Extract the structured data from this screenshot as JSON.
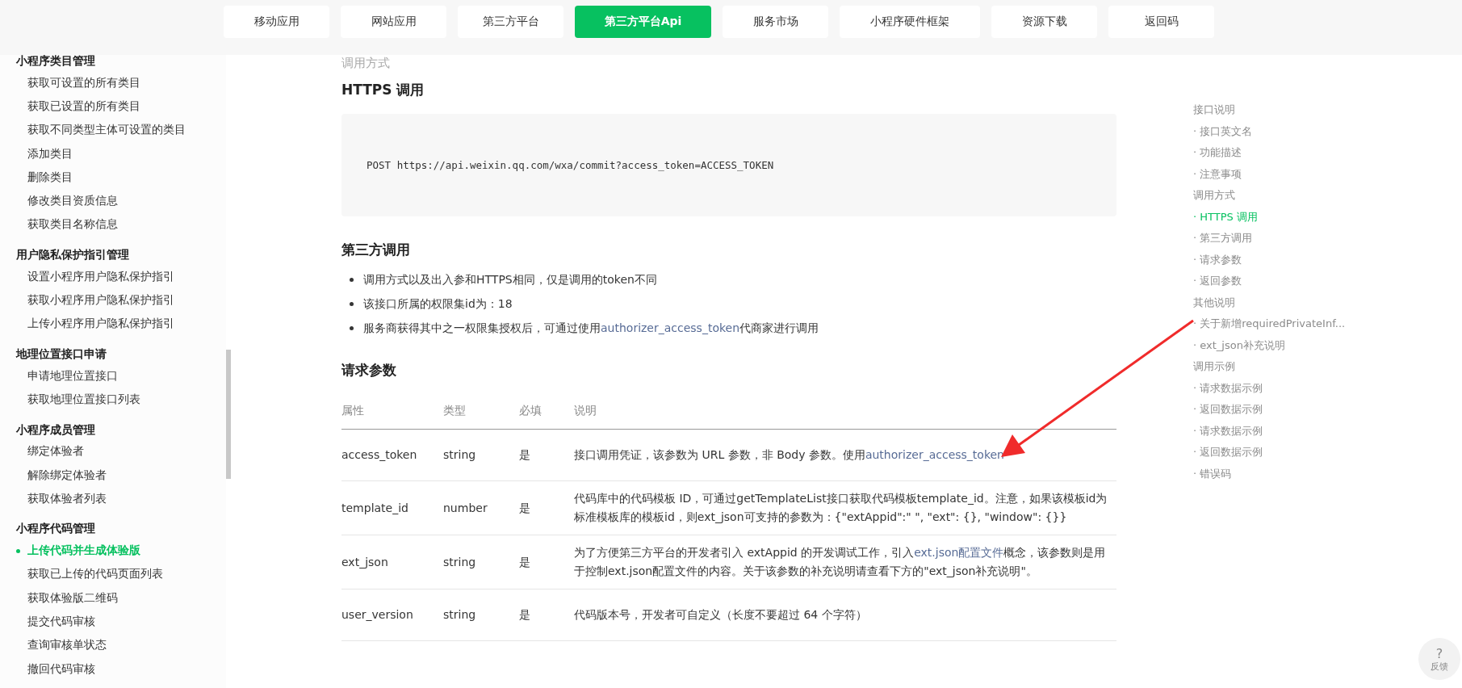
{
  "nav": {
    "items": [
      {
        "label": "移动应用",
        "selected": false
      },
      {
        "label": "网站应用",
        "selected": false
      },
      {
        "label": "第三方平台",
        "selected": false
      },
      {
        "label": "第三方平台Api",
        "selected": true
      },
      {
        "label": "服务市场",
        "selected": false
      },
      {
        "label": "小程序硬件框架",
        "selected": false
      },
      {
        "label": "资源下载",
        "selected": false
      },
      {
        "label": "返回码",
        "selected": false
      }
    ]
  },
  "sidebar": {
    "sections": [
      {
        "title": "小程序类目管理",
        "items": [
          {
            "label": "获取可设置的所有类目",
            "selected": false
          },
          {
            "label": "获取已设置的所有类目",
            "selected": false
          },
          {
            "label": "获取不同类型主体可设置的类目",
            "selected": false
          },
          {
            "label": "添加类目",
            "selected": false
          },
          {
            "label": "删除类目",
            "selected": false
          },
          {
            "label": "修改类目资质信息",
            "selected": false
          },
          {
            "label": "获取类目名称信息",
            "selected": false
          }
        ]
      },
      {
        "title": "用户隐私保护指引管理",
        "items": [
          {
            "label": "设置小程序用户隐私保护指引",
            "selected": false
          },
          {
            "label": "获取小程序用户隐私保护指引",
            "selected": false
          },
          {
            "label": "上传小程序用户隐私保护指引",
            "selected": false
          }
        ]
      },
      {
        "title": "地理位置接口申请",
        "items": [
          {
            "label": "申请地理位置接口",
            "selected": false
          },
          {
            "label": "获取地理位置接口列表",
            "selected": false
          }
        ]
      },
      {
        "title": "小程序成员管理",
        "items": [
          {
            "label": "绑定体验者",
            "selected": false
          },
          {
            "label": "解除绑定体验者",
            "selected": false
          },
          {
            "label": "获取体验者列表",
            "selected": false
          }
        ]
      },
      {
        "title": "小程序代码管理",
        "items": [
          {
            "label": "上传代码并生成体验版",
            "selected": true
          },
          {
            "label": "获取已上传的代码页面列表",
            "selected": false
          },
          {
            "label": "获取体验版二维码",
            "selected": false
          },
          {
            "label": "提交代码审核",
            "selected": false
          },
          {
            "label": "查询审核单状态",
            "selected": false
          },
          {
            "label": "撤回代码审核",
            "selected": false
          }
        ]
      }
    ]
  },
  "content": {
    "section_title": "调用方式",
    "https": {
      "title": "HTTPS 调用",
      "code": "POST https://api.weixin.qq.com/wxa/commit?access_token=ACCESS_TOKEN"
    },
    "third_party": {
      "title": "第三方调用",
      "bullets": [
        [
          {
            "kind": "text",
            "text": "调用方式以及出入参和HTTPS相同，仅是调用的token不同"
          }
        ],
        [
          {
            "kind": "text",
            "text": "该接口所属的权限集id为：18"
          }
        ],
        [
          {
            "kind": "text",
            "text": "服务商获得其中之一权限集授权后，可通过使用"
          },
          {
            "kind": "link",
            "text": "authorizer_access_token"
          },
          {
            "kind": "text",
            "text": "代商家进行调用"
          }
        ]
      ]
    },
    "params": {
      "title": "请求参数",
      "columns": [
        "属性",
        "类型",
        "必填",
        "说明"
      ],
      "rows": [
        {
          "name": "access_token",
          "type": "string",
          "required": "是",
          "description": [
            {
              "kind": "text",
              "text": "接口调用凭证，该参数为 URL 参数，非 Body 参数。使用"
            },
            {
              "kind": "link",
              "text": "authorizer_access_token"
            }
          ]
        },
        {
          "name": "template_id",
          "type": "number",
          "required": "是",
          "description": [
            {
              "kind": "text",
              "text": "代码库中的代码模板 ID，可通过getTemplateList接口获取代码模板template_id。注意，如果该模板id为标准模板库的模板id，则ext_json可支持的参数为：{\"extAppid\":\" \", \"ext\": {}, \"window\": {}}"
            }
          ]
        },
        {
          "name": "ext_json",
          "type": "string",
          "required": "是",
          "description": [
            {
              "kind": "text",
              "text": "为了方便第三方平台的开发者引入 extAppid 的开发调试工作，引入"
            },
            {
              "kind": "link",
              "text": "ext.json配置文件"
            },
            {
              "kind": "text",
              "text": "概念，该参数则是用于控制ext.json配置文件的内容。关于该参数的补充说明请查看下方的\"ext_json补充说明\"。"
            }
          ]
        },
        {
          "name": "user_version",
          "type": "string",
          "required": "是",
          "description": [
            {
              "kind": "text",
              "text": "代码版本号，开发者可自定义（长度不要超过 64 个字符）"
            }
          ]
        }
      ]
    }
  },
  "toc": {
    "items": [
      {
        "label": "接口说明",
        "selected": false
      },
      {
        "label": "· 接口英文名",
        "selected": false
      },
      {
        "label": "· 功能描述",
        "selected": false
      },
      {
        "label": "· 注意事项",
        "selected": false
      },
      {
        "label": "调用方式",
        "selected": false
      },
      {
        "label": "· HTTPS 调用",
        "selected": true
      },
      {
        "label": "· 第三方调用",
        "selected": false
      },
      {
        "label": "· 请求参数",
        "selected": false
      },
      {
        "label": "· 返回参数",
        "selected": false
      },
      {
        "label": "其他说明",
        "selected": false
      },
      {
        "label": "· 关于新增requiredPrivateInf...",
        "selected": false
      },
      {
        "label": "· ext_json补充说明",
        "selected": false
      },
      {
        "label": "调用示例",
        "selected": false
      },
      {
        "label": "· 请求数据示例",
        "selected": false
      },
      {
        "label": "· 返回数据示例",
        "selected": false
      },
      {
        "label": "· 请求数据示例",
        "selected": false
      },
      {
        "label": "· 返回数据示例",
        "selected": false
      },
      {
        "label": "· 错误码",
        "selected": false
      }
    ]
  },
  "feedback": {
    "icon": "?",
    "label": "反馈"
  }
}
